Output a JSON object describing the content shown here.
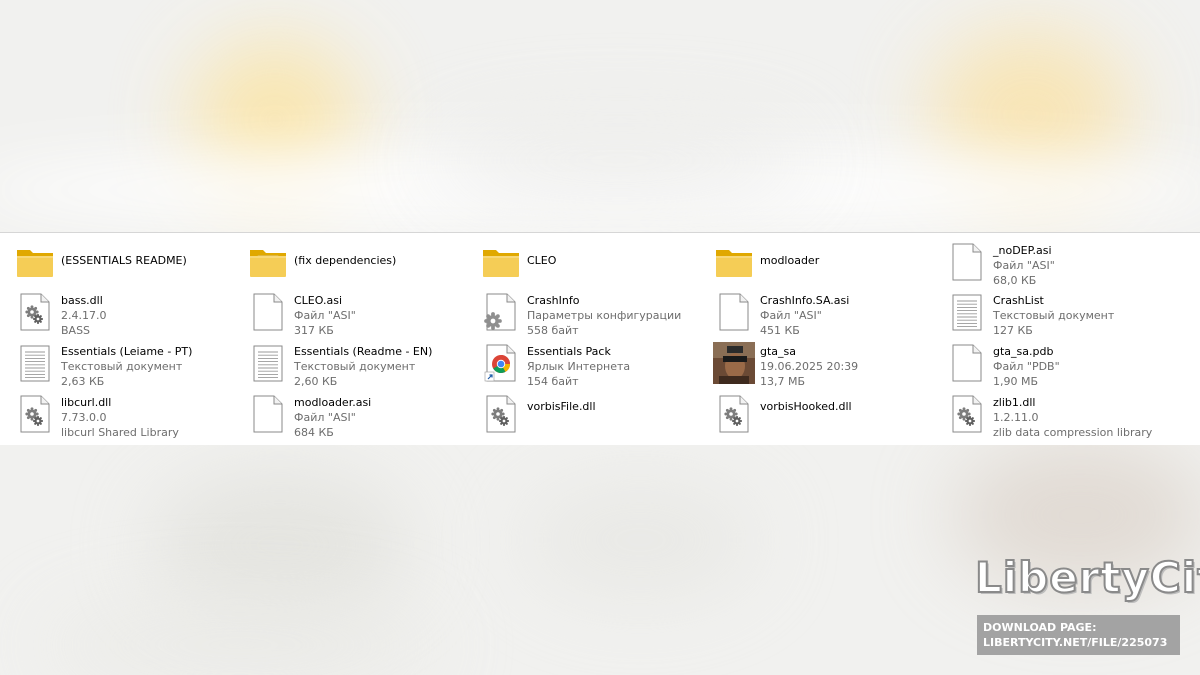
{
  "files": [
    {
      "name": "(ESSENTIALS README)",
      "line2": "",
      "line3": "",
      "icon": "folder-icon"
    },
    {
      "name": "(fix dependencies)",
      "line2": "",
      "line3": "",
      "icon": "folder-icon"
    },
    {
      "name": "CLEO",
      "line2": "",
      "line3": "",
      "icon": "folder-icon"
    },
    {
      "name": "modloader",
      "line2": "",
      "line3": "",
      "icon": "folder-icon"
    },
    {
      "name": "_noDEP.asi",
      "line2": "Файл \"ASI\"",
      "line3": "68,0 КБ",
      "icon": "blank-file-icon"
    },
    {
      "name": "bass.dll",
      "line2": "2.4.17.0",
      "line3": "BASS",
      "icon": "dll-gear-icon"
    },
    {
      "name": "CLEO.asi",
      "line2": "Файл \"ASI\"",
      "line3": "317 КБ",
      "icon": "blank-file-icon"
    },
    {
      "name": "CrashInfo",
      "line2": "Параметры конфигурации",
      "line3": "558 байт",
      "icon": "config-file-icon"
    },
    {
      "name": "CrashInfo.SA.asi",
      "line2": "Файл \"ASI\"",
      "line3": "451 КБ",
      "icon": "blank-file-icon"
    },
    {
      "name": "CrashList",
      "line2": "Текстовый документ",
      "line3": "127 КБ",
      "icon": "text-file-icon"
    },
    {
      "name": "Essentials (Leiame - PT)",
      "line2": "Текстовый документ",
      "line3": "2,63 КБ",
      "icon": "text-file-icon"
    },
    {
      "name": "Essentials (Readme - EN)",
      "line2": "Текстовый документ",
      "line3": "2,60 КБ",
      "icon": "text-file-icon"
    },
    {
      "name": "Essentials Pack",
      "line2": "Ярлык Интернета",
      "line3": "154 байт",
      "icon": "chrome-shortcut-icon"
    },
    {
      "name": "gta_sa",
      "line2": "19.06.2025 20:39",
      "line3": "13,7 МБ",
      "icon": "gta-sa-app-icon"
    },
    {
      "name": "gta_sa.pdb",
      "line2": "Файл \"PDB\"",
      "line3": "1,90 МБ",
      "icon": "blank-file-icon"
    },
    {
      "name": "libcurl.dll",
      "line2": "7.73.0.0",
      "line3": "libcurl Shared Library",
      "icon": "dll-gear-icon"
    },
    {
      "name": "modloader.asi",
      "line2": "Файл \"ASI\"",
      "line3": "684 КБ",
      "icon": "blank-file-icon"
    },
    {
      "name": "vorbisFile.dll",
      "line2": "",
      "line3": "",
      "icon": "dll-gear-icon"
    },
    {
      "name": "vorbisHooked.dll",
      "line2": "",
      "line3": "",
      "icon": "dll-gear-icon"
    },
    {
      "name": "zlib1.dll",
      "line2": "1.2.11.0",
      "line3": "zlib data compression library",
      "icon": "dll-gear-icon"
    }
  ],
  "watermark": {
    "logo_text": "LibertyCity",
    "download_line1": "DOWNLOAD PAGE:",
    "download_line2": "LIBERTYCITY.NET/FILE/225073"
  },
  "colors": {
    "folder": "#f2c94c",
    "folder_dark": "#e0a800",
    "secondary_text": "#6d6d6d",
    "download_bg": "#a3a3a3"
  }
}
